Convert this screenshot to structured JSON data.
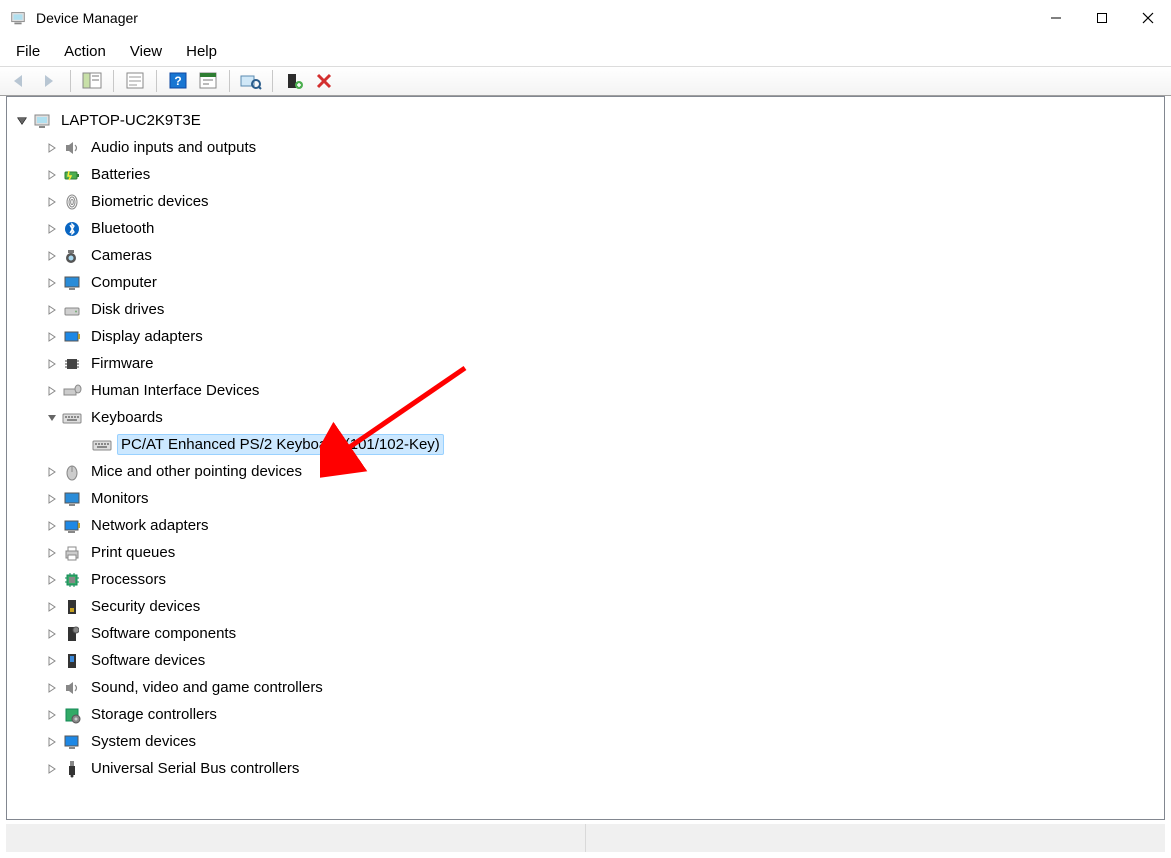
{
  "window": {
    "title": "Device Manager"
  },
  "menu": {
    "file": "File",
    "action": "Action",
    "view": "View",
    "help": "Help"
  },
  "toolbar": {
    "back": "Back",
    "forward": "Forward",
    "show_hide": "Show/Hide Console Tree",
    "properties": "Properties",
    "help": "Help",
    "update": "Update driver",
    "scan": "Scan for hardware changes",
    "add": "Add legacy hardware",
    "uninstall": "Uninstall device"
  },
  "tree": {
    "root": "LAPTOP-UC2K9T3E",
    "items": {
      "audio": "Audio inputs and outputs",
      "batteries": "Batteries",
      "biometric": "Biometric devices",
      "bluetooth": "Bluetooth",
      "cameras": "Cameras",
      "computer": "Computer",
      "disk": "Disk drives",
      "display": "Display adapters",
      "firmware": "Firmware",
      "hid": "Human Interface Devices",
      "keyboards": "Keyboards",
      "keyboard_device": "PC/AT Enhanced PS/2 Keyboard (101/102-Key)",
      "mice": "Mice and other pointing devices",
      "monitors": "Monitors",
      "network": "Network adapters",
      "printq": "Print queues",
      "processors": "Processors",
      "security": "Security devices",
      "swcomp": "Software components",
      "swdev": "Software devices",
      "sound": "Sound, video and game controllers",
      "storage": "Storage controllers",
      "system": "System devices",
      "usb": "Universal Serial Bus controllers"
    }
  }
}
